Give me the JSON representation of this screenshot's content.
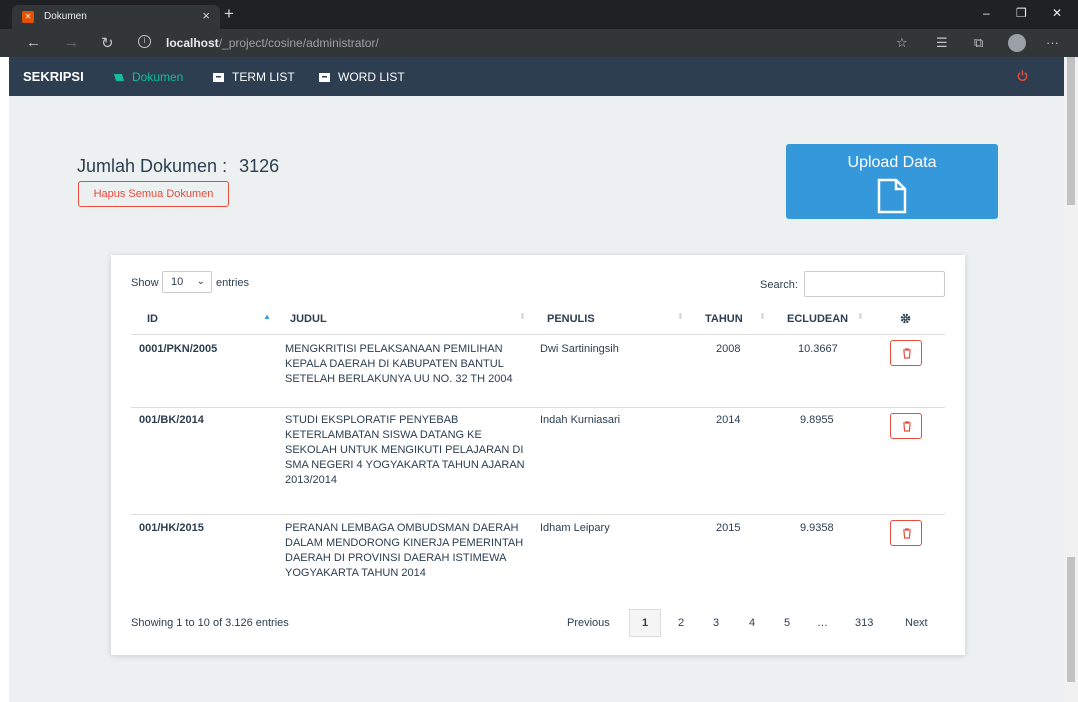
{
  "browser": {
    "tab_title": "Dokumen",
    "url_host": "localhost",
    "url_path": "/_project/cosine/administrator/"
  },
  "nav": {
    "brand": "SEKRIPSI",
    "items": [
      {
        "label": "Dokumen",
        "active": true
      },
      {
        "label": "TERM LIST",
        "active": false
      },
      {
        "label": "WORD LIST",
        "active": false
      }
    ]
  },
  "summary": {
    "jumlah_label": "Jumlah Dokumen :",
    "jumlah_value": "3126",
    "hapus_label": "Hapus Semua Dokumen",
    "upload_label": "Upload Data"
  },
  "table": {
    "show_label": "Show",
    "page_length": "10",
    "entries_label": "entries",
    "search_label": "Search:",
    "search_value": "",
    "columns": [
      "ID",
      "JUDUL",
      "PENULIS",
      "TAHUN",
      "ECLUDEAN"
    ],
    "rows": [
      {
        "id": "0001/PKN/2005",
        "judul": "MENGKRITISI PELAKSANAAN PEMILIHAN KEPALA DAERAH DI KABUPATEN BANTUL SETELAH BERLAKUNYA UU NO. 32 TH 2004",
        "penulis": "Dwi Sartiningsih",
        "tahun": "2008",
        "ecludean": "10.3667"
      },
      {
        "id": "001/BK/2014",
        "judul": "STUDI EKSPLORATIF PENYEBAB KETERLAMBATAN SISWA DATANG KE SEKOLAH UNTUK MENGIKUTI PELAJARAN DI SMA NEGERI 4 YOGYAKARTA TAHUN AJARAN 2013/2014",
        "penulis": "Indah Kurniasari",
        "tahun": "2014",
        "ecludean": "9.8955"
      },
      {
        "id": "001/HK/2015",
        "judul": "PERANAN LEMBAGA OMBUDSMAN DAERAH DALAM MENDORONG KINERJA PEMERINTAH DAERAH DI PROVINSI DAERAH ISTIMEWA YOGYAKARTA TAHUN 2014",
        "penulis": "Idham Leipary",
        "tahun": "2015",
        "ecludean": "9.9358"
      }
    ],
    "info": "Showing 1 to 10 of 3.126 entries",
    "pagination": {
      "previous": "Previous",
      "pages": [
        "1",
        "2",
        "3",
        "4",
        "5",
        "…",
        "313"
      ],
      "current": "1",
      "next": "Next"
    }
  },
  "colors": {
    "navbar": "#2c3e50",
    "accent": "#18bc9c",
    "primary": "#3498db",
    "danger": "#e74c3c",
    "page_bg": "#ecf0f1"
  }
}
